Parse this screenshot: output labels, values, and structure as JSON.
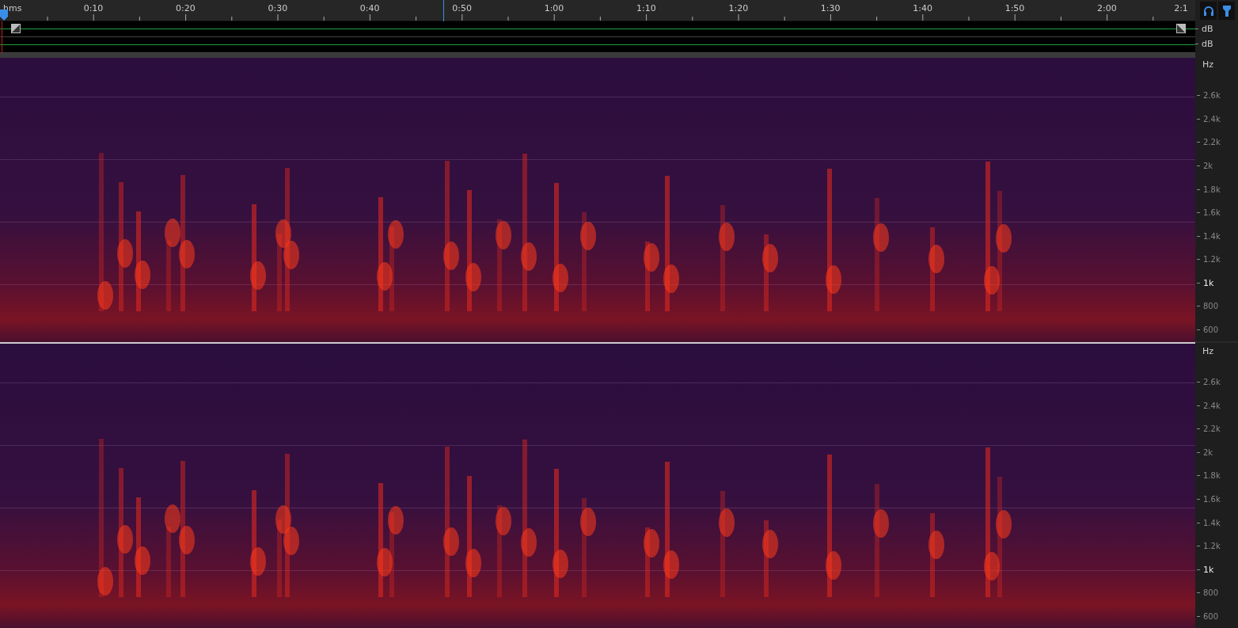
{
  "ruler": {
    "unit": "hms",
    "labels": [
      "0:10",
      "0:20",
      "0:30",
      "0:40",
      "0:50",
      "1:00",
      "1:10",
      "1:20",
      "1:30",
      "1:40",
      "1:50",
      "2:00",
      "2:1"
    ]
  },
  "lanes": [
    {
      "unit": "dB"
    },
    {
      "unit": "dB"
    }
  ],
  "channels": [
    {
      "unit": "Hz",
      "labels": [
        {
          "text": "2.6k",
          "major": false
        },
        {
          "text": "2.4k",
          "major": false
        },
        {
          "text": "2.2k",
          "major": false
        },
        {
          "text": "2k",
          "major": false
        },
        {
          "text": "1.8k",
          "major": false
        },
        {
          "text": "1.6k",
          "major": false
        },
        {
          "text": "1.4k",
          "major": false
        },
        {
          "text": "1.2k",
          "major": false
        },
        {
          "text": "1k",
          "major": true
        },
        {
          "text": "800",
          "major": false
        },
        {
          "text": "600",
          "major": false
        }
      ]
    },
    {
      "unit": "Hz",
      "labels": [
        {
          "text": "2.6k",
          "major": false
        },
        {
          "text": "2.4k",
          "major": false
        },
        {
          "text": "2.2k",
          "major": false
        },
        {
          "text": "2k",
          "major": false
        },
        {
          "text": "1.8k",
          "major": false
        },
        {
          "text": "1.6k",
          "major": false
        },
        {
          "text": "1.4k",
          "major": false
        },
        {
          "text": "1.2k",
          "major": false
        },
        {
          "text": "1k",
          "major": true
        },
        {
          "text": "800",
          "major": false
        },
        {
          "text": "600",
          "major": false
        }
      ]
    }
  ]
}
